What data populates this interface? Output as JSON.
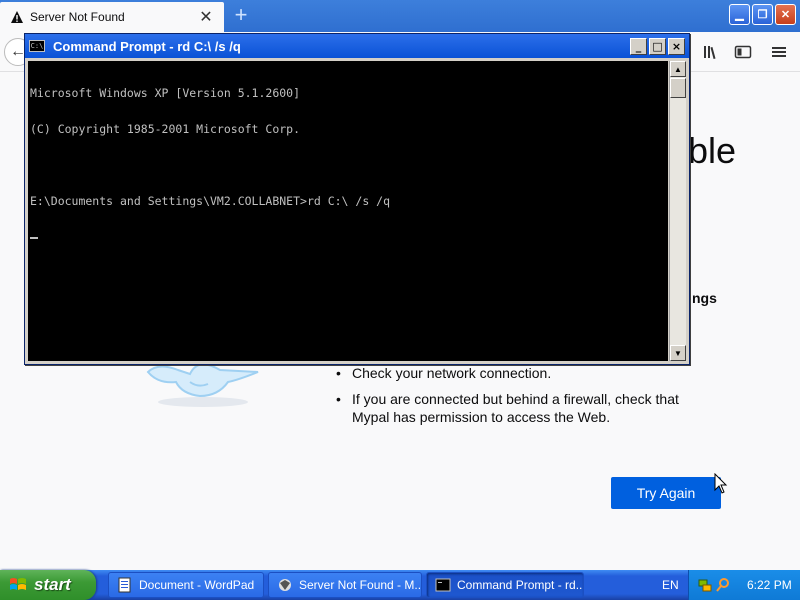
{
  "browser": {
    "tab_title": "Server Not Found",
    "new_tab_label": "+",
    "page_title_fragment": "ble",
    "settings_fragment": "ngs",
    "tips": [
      "Check your network connection.",
      "If you are connected but behind a firewall, check that Mypal has permission to access the Web."
    ],
    "try_again_label": "Try Again"
  },
  "cmd": {
    "title": "Command Prompt - rd C:\\ /s /q",
    "icon_text": "C:\\",
    "minimize_label": "_",
    "maximize_label": "□",
    "close_label": "×",
    "lines": [
      "Microsoft Windows XP [Version 5.1.2600]",
      "(C) Copyright 1985-2001 Microsoft Corp.",
      "",
      "E:\\Documents and Settings\\VM2.COLLABNET>rd C:\\ /s /q"
    ]
  },
  "taskbar": {
    "start_label": "start",
    "tasks": [
      "Document - WordPad",
      "Server Not Found - M...",
      "Command Prompt - rd..."
    ],
    "language": "EN",
    "clock": "6:22 PM"
  },
  "colors": {
    "try_again": "#0060df",
    "cmd_title_bar": "#0a52d6",
    "taskbar": "#245edb",
    "start": "#3c9a35"
  }
}
